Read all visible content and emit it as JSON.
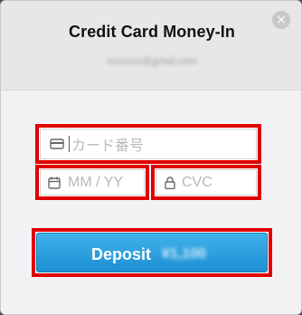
{
  "modal": {
    "title": "Credit Card Money-In",
    "email": "xxxxxxx@gmail.com",
    "close_icon": "×"
  },
  "form": {
    "card_number_placeholder": "カード番号",
    "expiry_placeholder": "MM / YY",
    "cvc_placeholder": "CVC"
  },
  "deposit": {
    "label": "Deposit",
    "amount": "¥1,100"
  },
  "colors": {
    "accent": "#1d8fd3",
    "highlight_border": "#e00000"
  },
  "icons": {
    "card": "credit-card-icon",
    "calendar": "calendar-icon",
    "lock": "lock-icon",
    "close": "close-icon"
  }
}
